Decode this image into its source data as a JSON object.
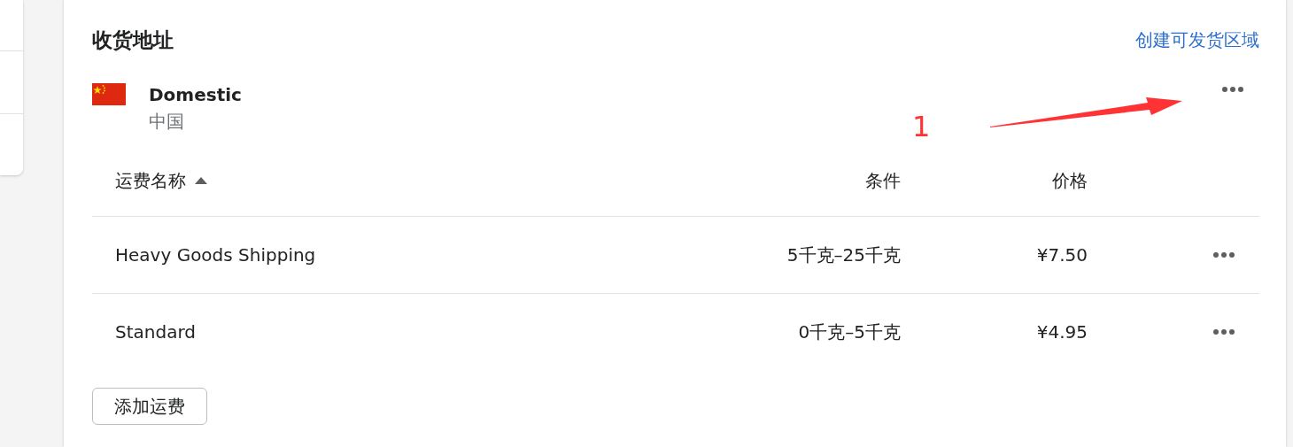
{
  "section": {
    "title": "收货地址",
    "action_link": "创建可发货区域"
  },
  "zone": {
    "name": "Domestic",
    "country": "中国"
  },
  "annotation": {
    "label": "1"
  },
  "table": {
    "columns": [
      {
        "label": "运费名称",
        "sorted": true
      },
      {
        "label": "条件"
      },
      {
        "label": "价格"
      }
    ],
    "rows": [
      {
        "name": "Heavy Goods Shipping",
        "condition": "5千克–25千克",
        "price": "¥7.50"
      },
      {
        "name": "Standard",
        "condition": "0千克–5千克",
        "price": "¥4.95"
      }
    ]
  },
  "add_button": "添加运费"
}
